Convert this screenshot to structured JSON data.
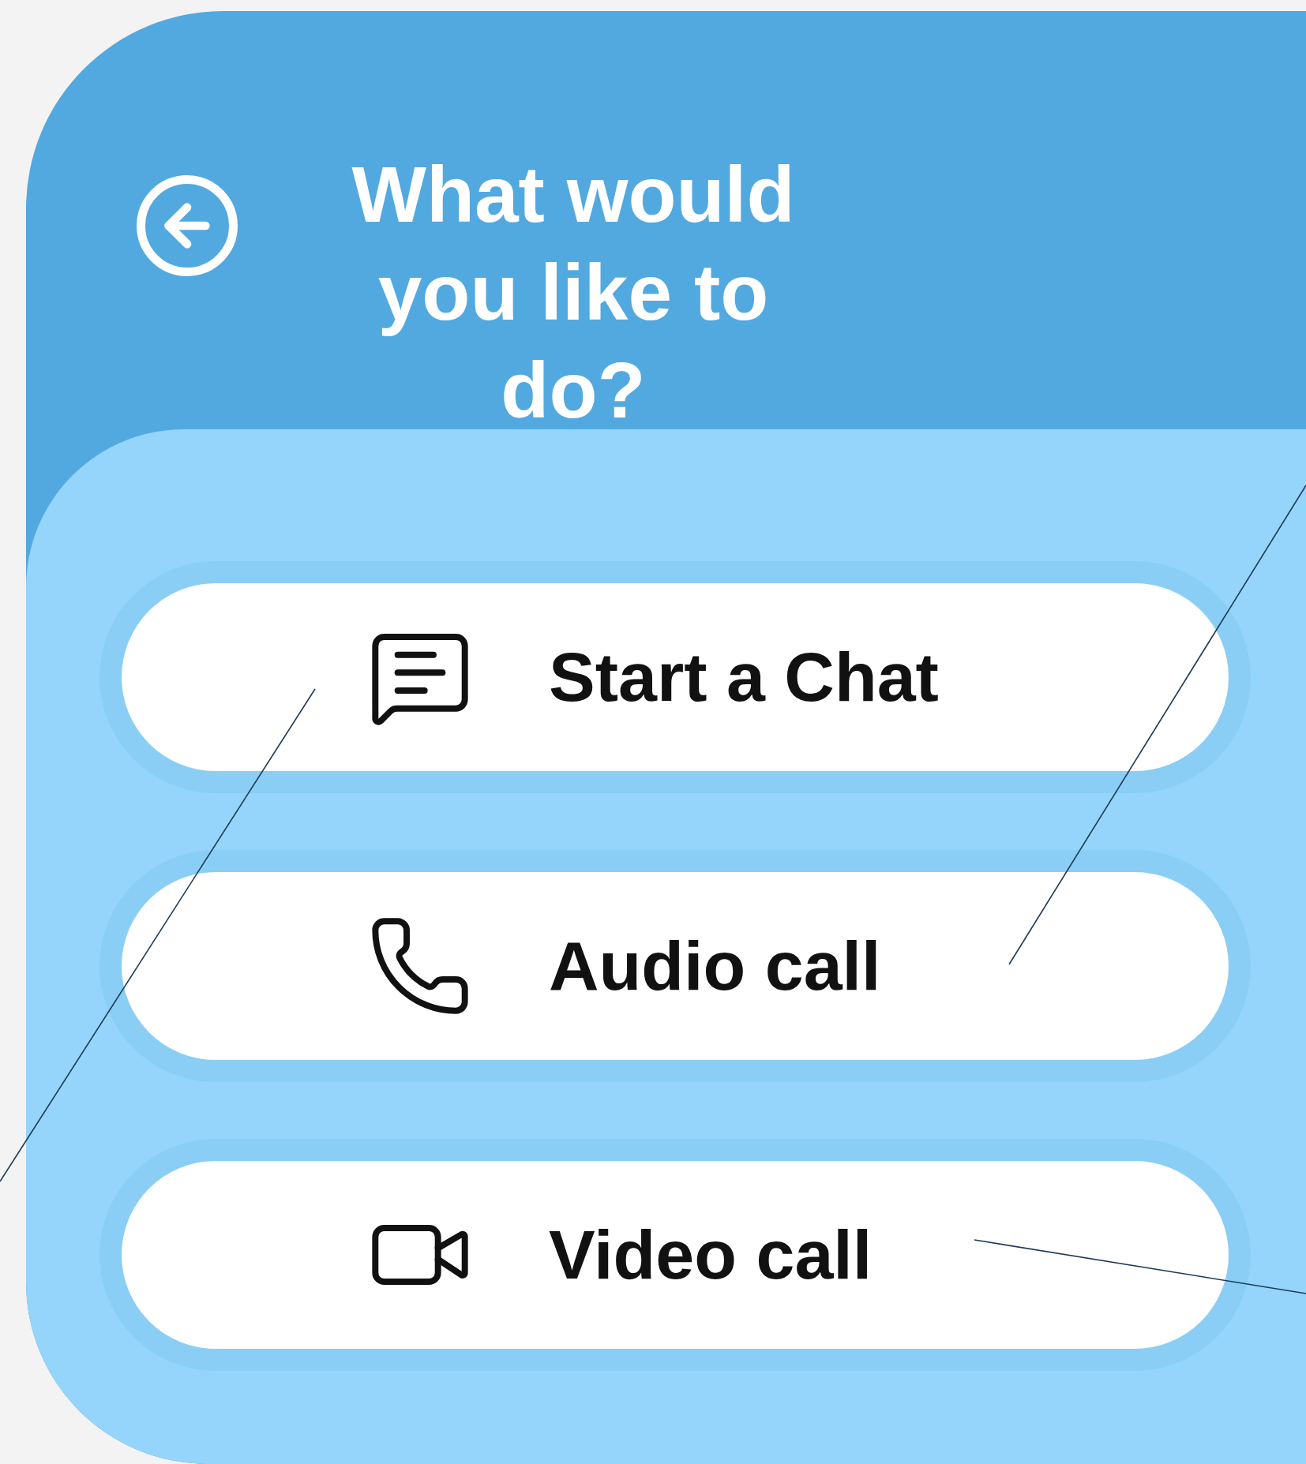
{
  "header": {
    "title": "What would you like to do?",
    "back_button": true
  },
  "options": [
    {
      "kind": "chat",
      "label": "Start a Chat"
    },
    {
      "kind": "audio",
      "label": "Audio call"
    },
    {
      "kind": "video",
      "label": "Video call"
    }
  ]
}
